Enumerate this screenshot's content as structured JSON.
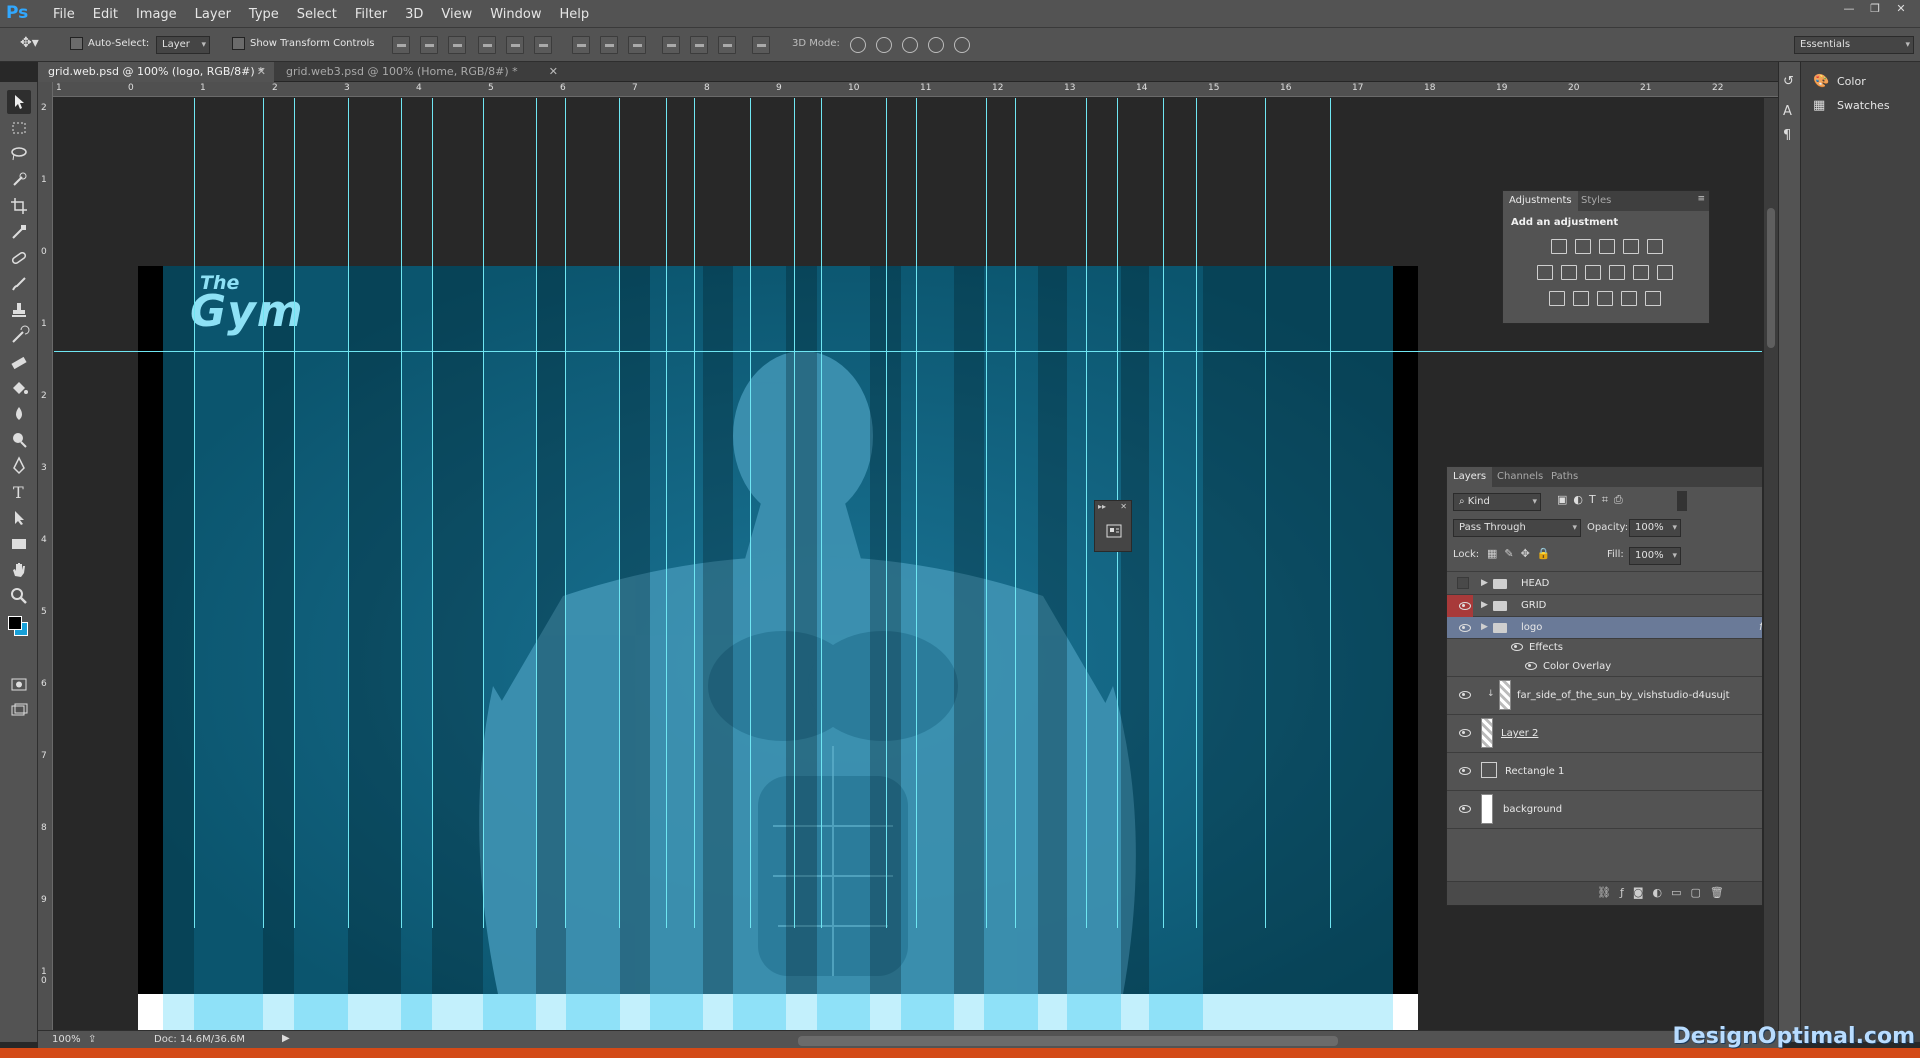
{
  "app": {
    "logo": "Ps"
  },
  "menu": [
    "File",
    "Edit",
    "Image",
    "Layer",
    "Type",
    "Select",
    "Filter",
    "3D",
    "View",
    "Window",
    "Help"
  ],
  "options_bar": {
    "auto_select_label": "Auto-Select:",
    "auto_select_value": "Layer",
    "show_transform_label": "Show Transform Controls",
    "mode_3d_label": "3D Mode:",
    "workspace": "Essentials"
  },
  "tabs": [
    {
      "label": "grid.web.psd @ 100% (logo, RGB/8#) *",
      "active": true
    },
    {
      "label": "grid.web3.psd @ 100% (Home, RGB/8#) *",
      "active": false
    }
  ],
  "ruler": {
    "h": [
      "1",
      "0",
      "1",
      "2",
      "3",
      "4",
      "5",
      "6",
      "7",
      "8",
      "9",
      "10",
      "11",
      "12",
      "13",
      "14",
      "15",
      "16",
      "17",
      "18",
      "19",
      "20",
      "21",
      "22"
    ],
    "v": [
      "2",
      "1",
      "0",
      "1",
      "2",
      "3",
      "4",
      "5",
      "6",
      "7",
      "8",
      "9",
      "1\n0"
    ]
  },
  "canvas": {
    "logo_the": "The",
    "logo_gym": "Gym"
  },
  "status": {
    "zoom": "100%",
    "doc": "Doc: 14.6M/36.6M"
  },
  "adjustments": {
    "tabs": [
      "Adjustments",
      "Styles"
    ],
    "title": "Add an adjustment"
  },
  "layers": {
    "tabs": [
      "Layers",
      "Channels",
      "Paths"
    ],
    "filter": "Kind",
    "blend_mode": "Pass Through",
    "opacity_label": "Opacity:",
    "opacity": "100%",
    "lock_label": "Lock:",
    "fill_label": "Fill:",
    "fill": "100%",
    "items": [
      {
        "name": "HEAD",
        "type": "group",
        "visible": false
      },
      {
        "name": "GRID",
        "type": "group",
        "visible": true
      },
      {
        "name": "logo",
        "type": "group",
        "visible": true,
        "selected": true
      },
      {
        "name": "Effects",
        "type": "effects"
      },
      {
        "name": "Color Overlay",
        "type": "effect"
      },
      {
        "name": "far_side_of_the_sun_by_vishstudio-d4usujt",
        "type": "layer",
        "visible": true
      },
      {
        "name": "Layer 2",
        "type": "layer",
        "visible": true
      },
      {
        "name": "Rectangle 1",
        "type": "layer",
        "visible": true
      },
      {
        "name": "background",
        "type": "layer",
        "visible": true
      }
    ]
  },
  "right_panels": [
    {
      "label": "Color",
      "icon": "color-palette-icon"
    },
    {
      "label": "Swatches",
      "icon": "swatches-grid-icon"
    }
  ],
  "watermark": "DesignOptimal.com",
  "colors": {
    "accent_guide": "#6fe6f2",
    "logo": "#8ee1f5",
    "canvas_blue": "#0b556e",
    "strip": "#8fe1f8"
  }
}
